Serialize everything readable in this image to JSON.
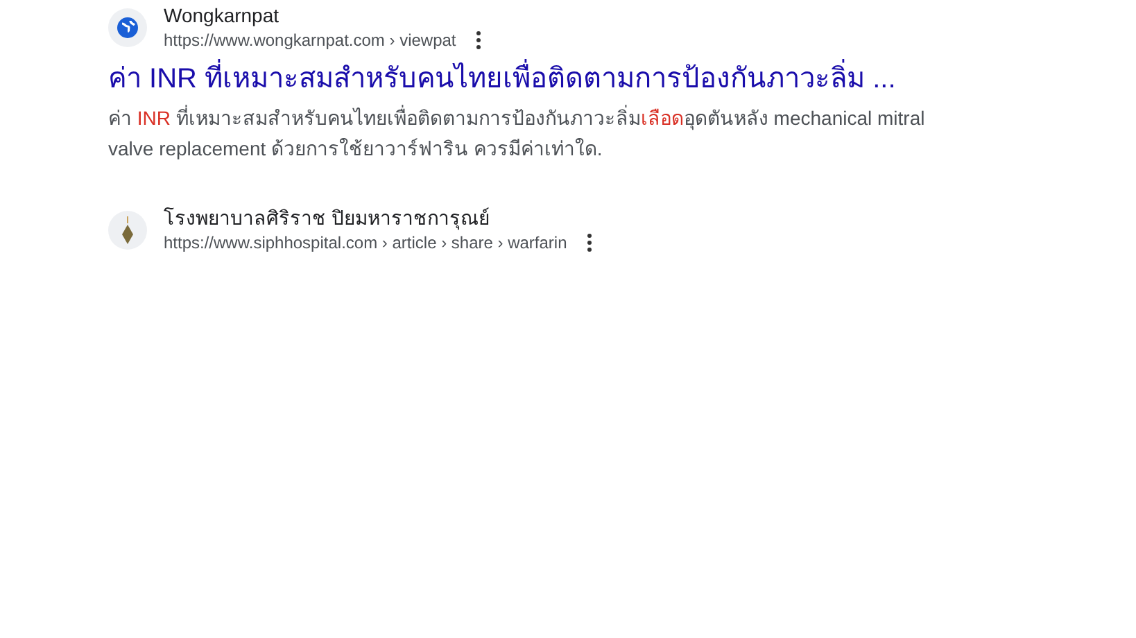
{
  "results": [
    {
      "site": "Wongkarnpat",
      "url": "https://www.wongkarnpat.com › viewpat",
      "kind": "globe",
      "title": "ค่า INR ที่เหมาะสมสำหรับคนไทยเพื่อติดตามการป้องกันภาวะลิ่ม ...",
      "snippet": [
        {
          "text": "ค่า ",
          "highlighted": false
        },
        {
          "text": "INR",
          "highlighted": true
        },
        {
          "text": " ที่เหมาะสมสำหรับคนไทยเพื่อติดตามการป้องกันภาวะลิ่ม",
          "highlighted": false
        },
        {
          "text": "เลือด",
          "highlighted": true
        },
        {
          "text": "อุดตันหลัง mechanical mitral valve replacement ด้วยการใช้ยาวาร์ฟาริน ควรมีค่าเท่าใด.",
          "highlighted": false
        }
      ]
    },
    {
      "site": "โรงพยาบาลศิริราช ปิยมหาราชการุณย์",
      "url": "https://www.siphhospital.com › article › share › warfarin",
      "kind": "emblem"
    }
  ]
}
